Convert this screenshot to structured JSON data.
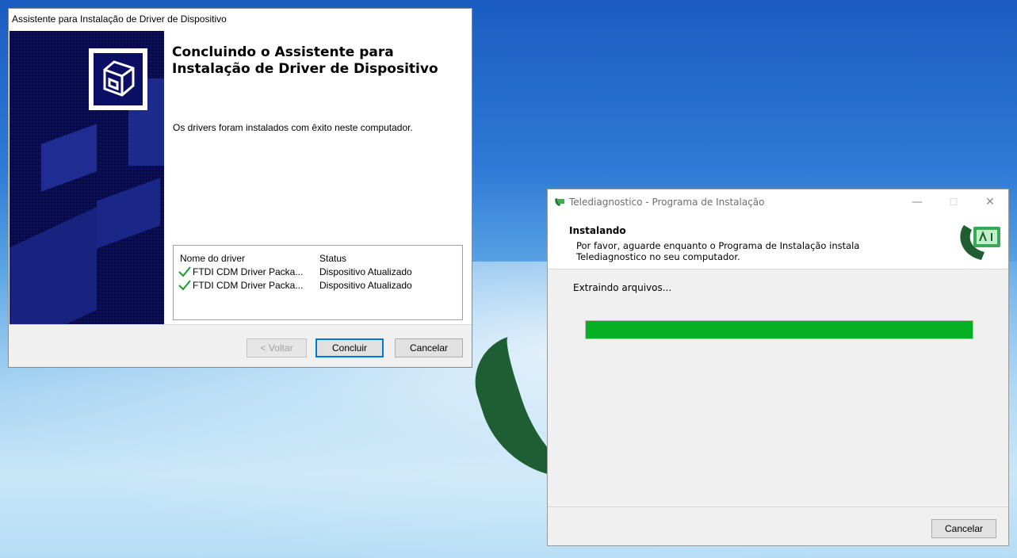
{
  "wizard": {
    "title": "Assistente para Instalação de Driver de Dispositivo",
    "heading": "Concluindo o Assistente para Instalação de Driver de Dispositivo",
    "message": "Os drivers foram instalados com êxito neste computador.",
    "table": {
      "columns": [
        "Nome do driver",
        "Status"
      ],
      "rows": [
        {
          "name": "FTDI CDM Driver Packa...",
          "status": "Dispositivo Atualizado"
        },
        {
          "name": "FTDI CDM Driver Packa...",
          "status": "Dispositivo Atualizado"
        }
      ]
    },
    "buttons": {
      "back": "< Voltar",
      "finish": "Concluir",
      "cancel": "Cancelar"
    }
  },
  "installer": {
    "title": "Telediagnostico - Programa de Instalação",
    "header_title": "Instalando",
    "header_desc": "Por favor, aguarde enquanto o Programa de Instalação instala Telediagnostico no seu computador.",
    "status": "Extraindo arquivos...",
    "progress": 1.0,
    "buttons": {
      "cancel": "Cancelar"
    }
  },
  "colors": {
    "progress": "#06b025",
    "wizard_sidebar": "#0b0f64",
    "brand_green": "#1f5e33"
  }
}
